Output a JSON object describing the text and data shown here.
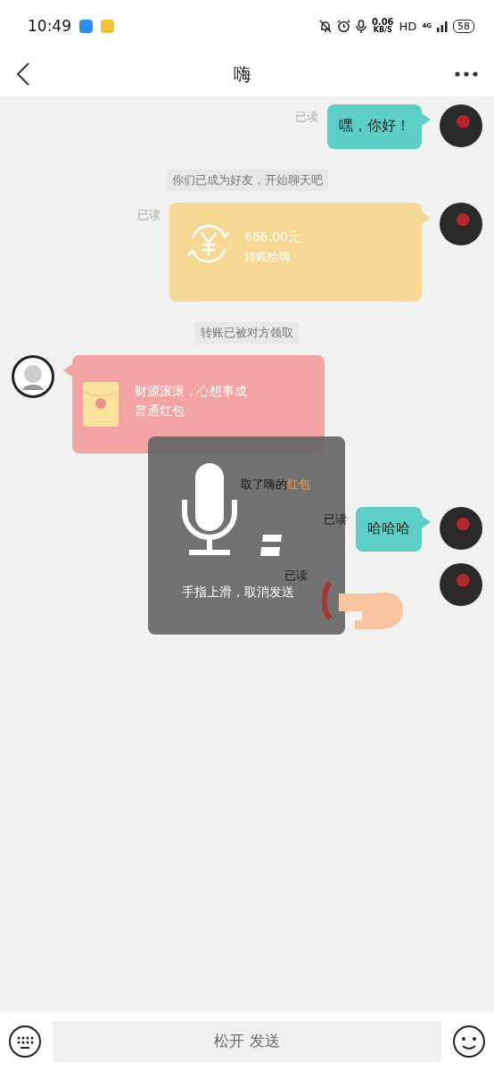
{
  "status_bar": {
    "time": "10:49",
    "net_speed": "0.06",
    "net_unit": "KB/S",
    "hd": "HD",
    "network": "4G",
    "battery": "58"
  },
  "header": {
    "title": "嗨"
  },
  "messages": [
    {
      "kind": "text",
      "outgoing": true,
      "read": "已读",
      "text": "嘿，你好！"
    },
    {
      "kind": "system",
      "text": "你们已成为好友，开始聊天吧"
    },
    {
      "kind": "transfer",
      "outgoing": true,
      "read": "已读",
      "amount": "666.00元",
      "note": "转账给嗨"
    },
    {
      "kind": "system",
      "text": "转账已被对方领取"
    },
    {
      "kind": "redpacket",
      "outgoing": false,
      "greeting": "财源滚滚，心想事成",
      "type_label": "普通红包"
    },
    {
      "kind": "system",
      "text": "取了嗨的",
      "link": "红包"
    },
    {
      "kind": "text",
      "outgoing": true,
      "read": "已读",
      "text": "哈哈哈"
    },
    {
      "kind": "pending",
      "outgoing": true,
      "read": "已读"
    }
  ],
  "recording": {
    "hint": "手指上滑，取消发送"
  },
  "input_bar": {
    "hold_button": "松开 发送"
  }
}
